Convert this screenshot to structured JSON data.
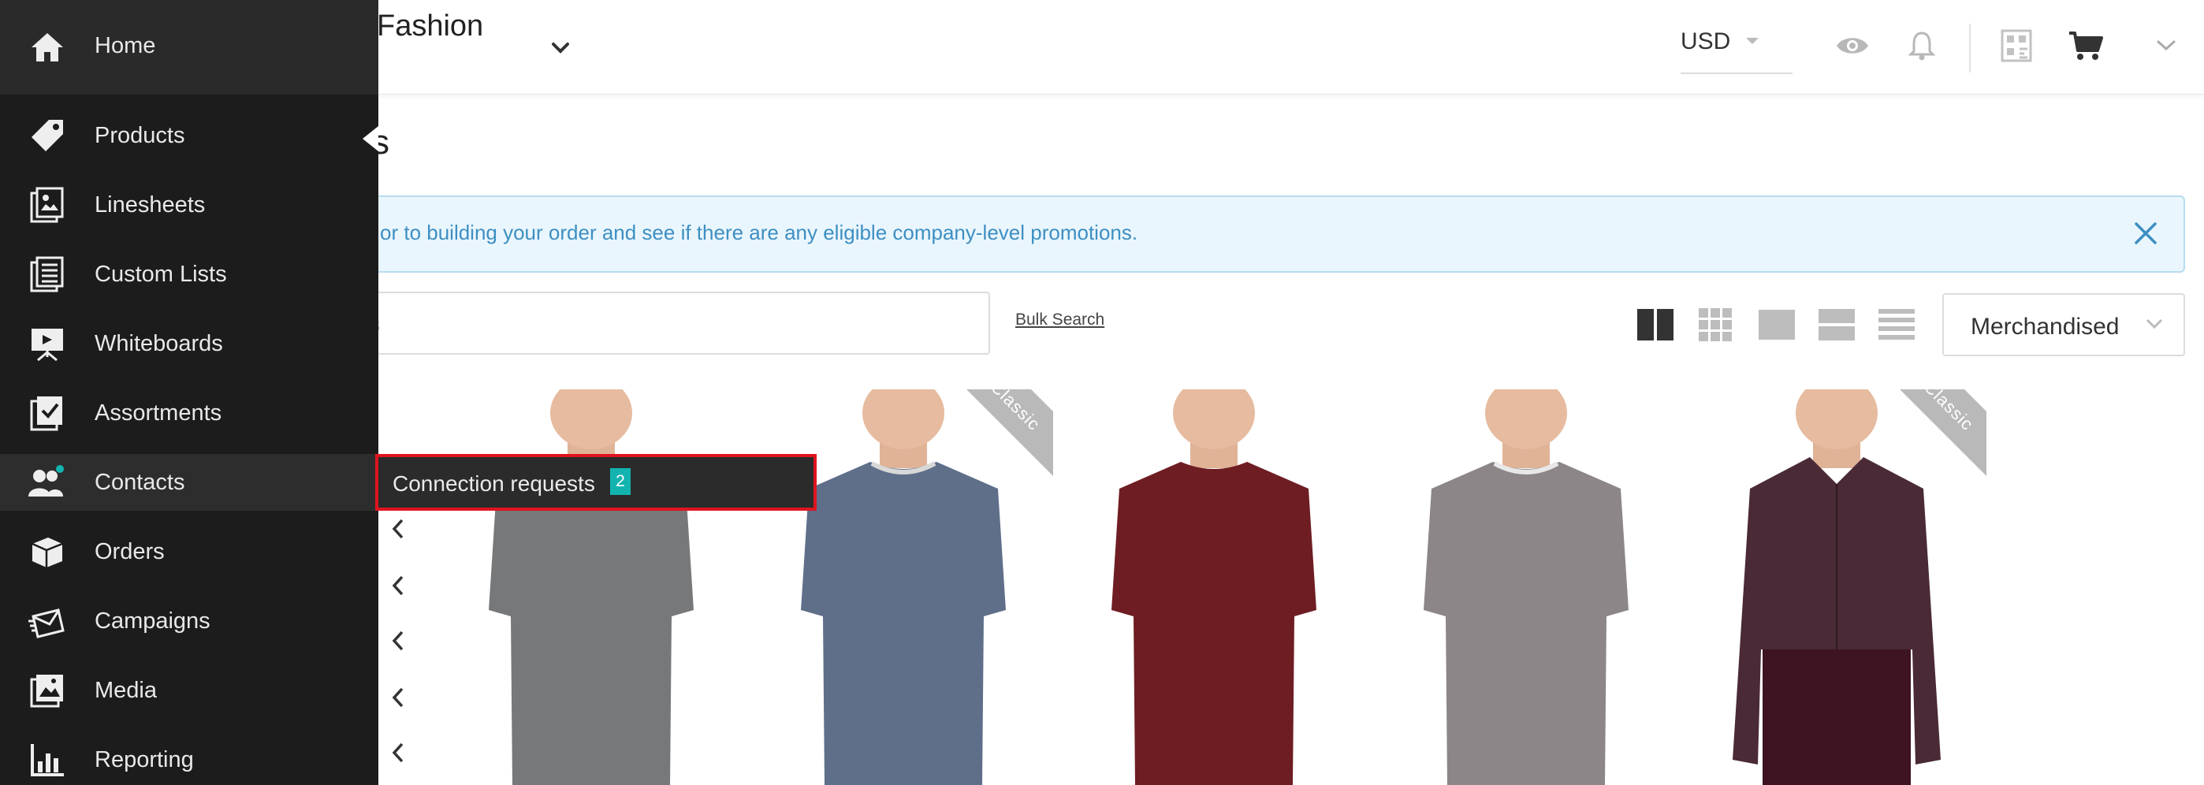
{
  "header": {
    "brand_title": "N Fashion",
    "currency": "USD",
    "icons": [
      "eye-icon",
      "bell-icon",
      "qr-icon",
      "cart-icon",
      "chevron-down-icon"
    ]
  },
  "page": {
    "title": "s",
    "alert_text": "or to building your order and see if there are any eligible company-level promotions.",
    "search_placeholder": "ts",
    "bulk_search_label": "Bulk Search",
    "sort_value": "Merchandised"
  },
  "products": [
    {
      "shirt_color": "#77787a",
      "ribbon": ""
    },
    {
      "shirt_color": "#5f6f8a",
      "ribbon": "Classic"
    },
    {
      "shirt_color": "#6e1d22",
      "ribbon": ""
    },
    {
      "shirt_color": "#8c8688",
      "ribbon": ""
    },
    {
      "shirt_color": "#4a2a36",
      "ribbon": "Classic"
    }
  ],
  "sidebar": {
    "items": [
      {
        "label": "Home",
        "icon": "home-icon"
      },
      {
        "label": "Products",
        "icon": "tag-icon"
      },
      {
        "label": "Linesheets",
        "icon": "linesheets-icon"
      },
      {
        "label": "Custom Lists",
        "icon": "list-icon"
      },
      {
        "label": "Whiteboards",
        "icon": "whiteboard-icon"
      },
      {
        "label": "Assortments",
        "icon": "assortments-icon"
      },
      {
        "label": "Contacts",
        "icon": "contacts-icon"
      },
      {
        "label": "Orders",
        "icon": "box-icon"
      },
      {
        "label": "Campaigns",
        "icon": "campaign-icon"
      },
      {
        "label": "Media",
        "icon": "media-icon"
      },
      {
        "label": "Reporting",
        "icon": "chart-icon"
      }
    ]
  },
  "flyout": {
    "label": "Connection requests",
    "badge": "2"
  },
  "colors": {
    "sidebar_bg": "#1c1c1c",
    "accent_teal": "#13b4b0",
    "highlight_red": "#e0141e",
    "alert_text": "#3d8fc3"
  }
}
